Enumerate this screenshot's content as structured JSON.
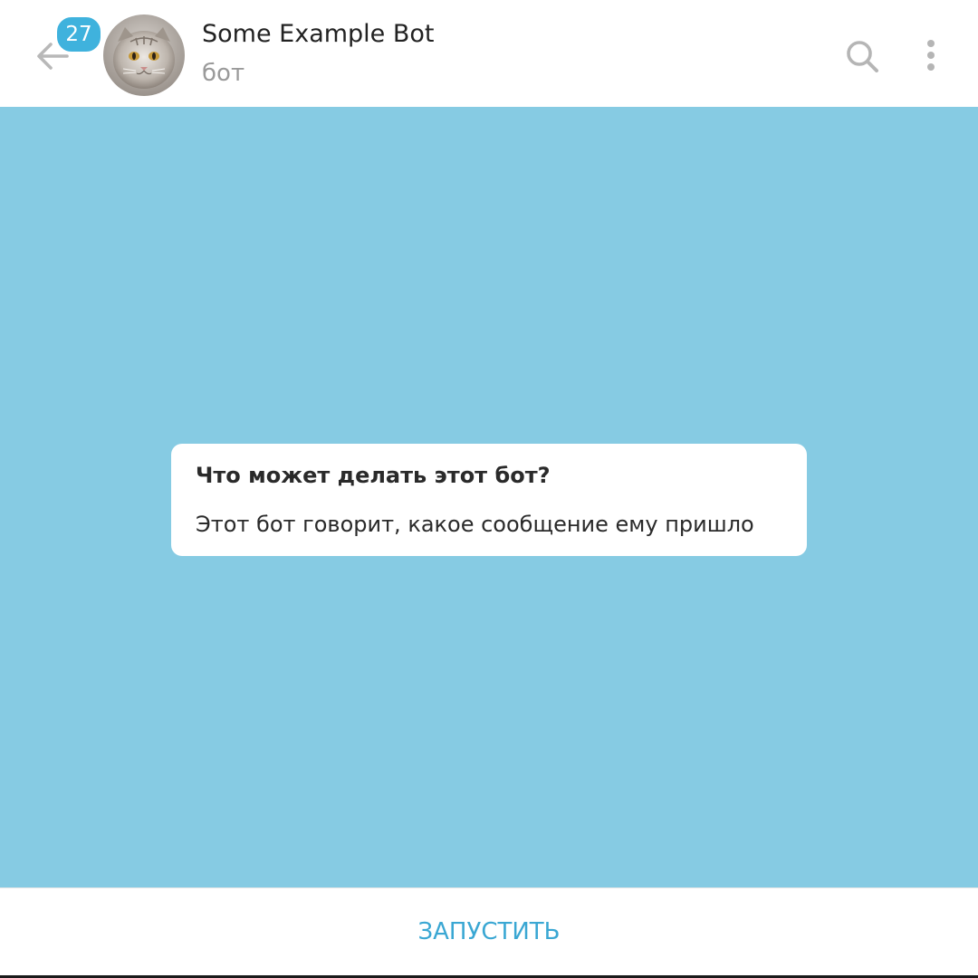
{
  "header": {
    "unread_count": "27",
    "title": "Some Example Bot",
    "subtitle": "бот",
    "icons": {
      "back": "arrow-left-icon",
      "search": "search-icon",
      "menu": "more-vertical-icon"
    }
  },
  "chat": {
    "background_color": "#86cbe3",
    "bot_info": {
      "title": "Что может делать этот бот?",
      "description": "Этот бот говорит, какое сообщение ему пришло"
    }
  },
  "bottom_bar": {
    "start_label": "ЗАПУСТИТЬ",
    "accent_color": "#3aa7d3"
  },
  "colors": {
    "badge": "#3fb2dd",
    "title_text": "#222222",
    "subtitle_text": "#9a9a9a",
    "icon_gray": "#b5b5b5"
  }
}
